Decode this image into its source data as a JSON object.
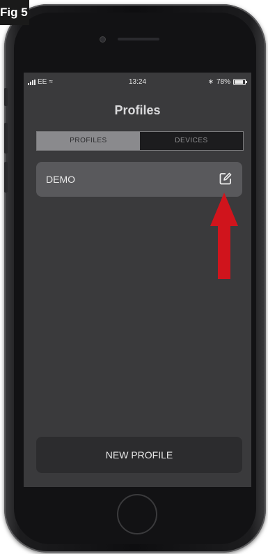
{
  "figure": {
    "label": "Fig 5"
  },
  "status_bar": {
    "carrier": "EE",
    "time": "13:24",
    "battery": "78%"
  },
  "header": {
    "title": "Profiles"
  },
  "tabs": [
    {
      "label": "PROFILES",
      "selected": true
    },
    {
      "label": "DEVICES",
      "selected": false
    }
  ],
  "profiles": [
    {
      "name": "DEMO"
    }
  ],
  "actions": {
    "new_profile_label": "NEW PROFILE"
  },
  "colors": {
    "screen_bg": "#3a3a3c",
    "row_bg": "#59595c",
    "arrow": "#d0141c"
  },
  "icons": {
    "edit": "edit-icon",
    "annotation": "red-arrow-up"
  }
}
